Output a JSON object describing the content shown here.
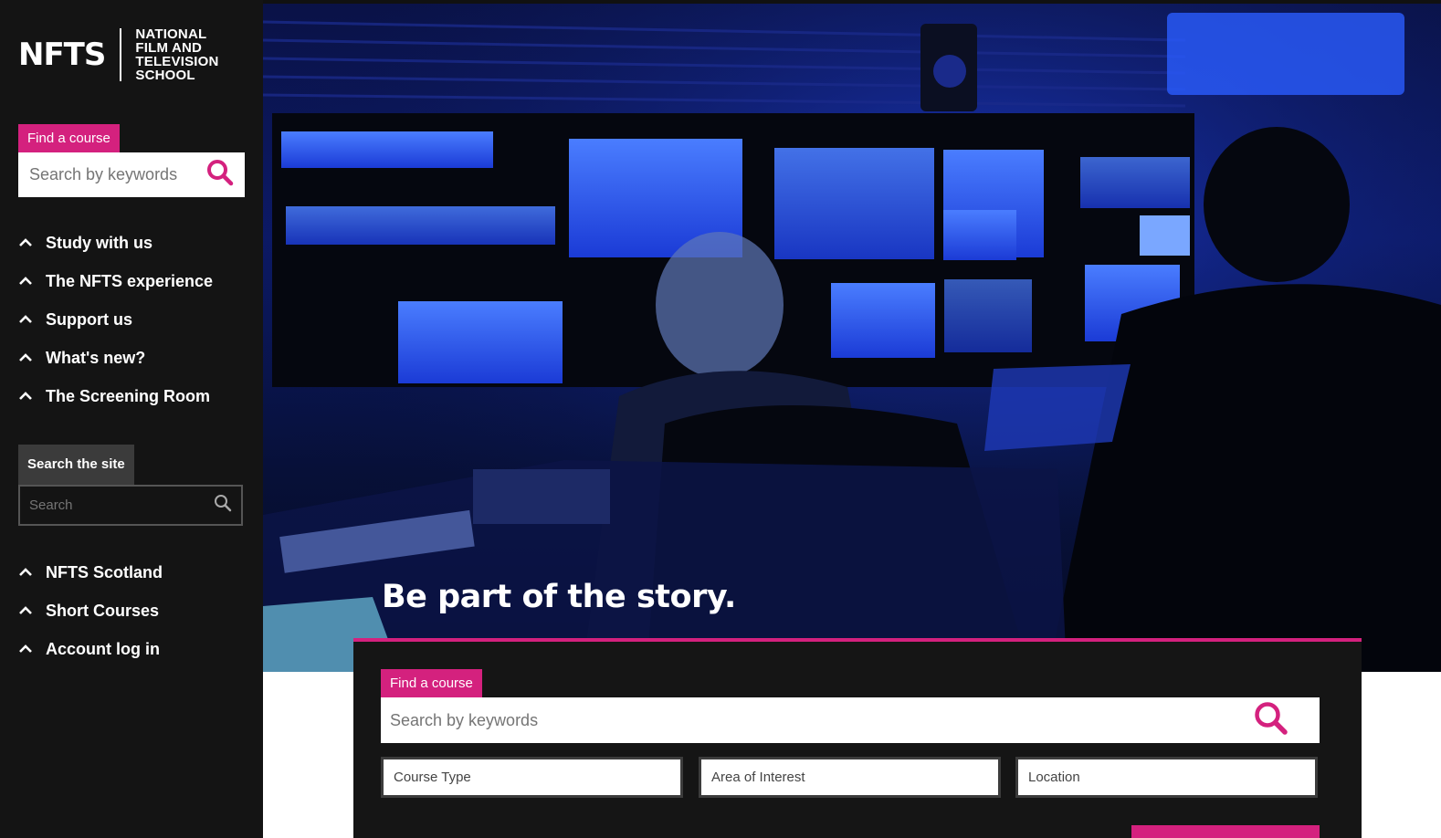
{
  "logo": {
    "mark": "NFTS",
    "lines": [
      "NATIONAL",
      "FILM AND",
      "TELEVISION",
      "SCHOOL"
    ]
  },
  "sidebar": {
    "find_course_label": "Find a course",
    "course_search_placeholder": "Search by keywords",
    "nav_primary": [
      {
        "label": "Study with us"
      },
      {
        "label": "The NFTS experience"
      },
      {
        "label": "Support us"
      },
      {
        "label": "What's new?"
      },
      {
        "label": "The Screening Room"
      }
    ],
    "site_search_label": "Search the site",
    "site_search_placeholder": "Search",
    "nav_secondary": [
      {
        "label": "NFTS Scotland"
      },
      {
        "label": "Short Courses"
      },
      {
        "label": "Account log in"
      }
    ]
  },
  "hero": {
    "title": "Be part of the story."
  },
  "course_finder": {
    "label": "Find a course",
    "search_placeholder": "Search by keywords",
    "filters": [
      "Course Type",
      "Area of Interest",
      "Location"
    ]
  },
  "colors": {
    "accent": "#d4217e",
    "sidebar_bg": "#141414"
  }
}
